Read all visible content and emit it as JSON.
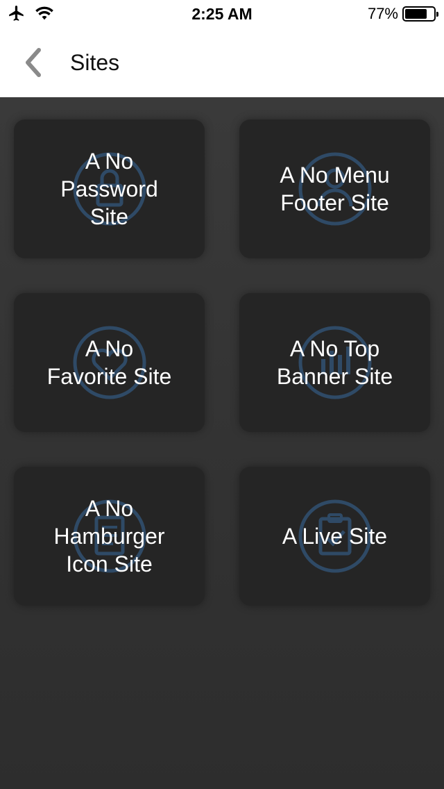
{
  "status_bar": {
    "time": "2:25 AM",
    "battery_percent": "77%",
    "battery_level": 0.77,
    "icons": [
      "airplane-icon",
      "wifi-icon",
      "battery-icon"
    ]
  },
  "nav": {
    "title": "Sites",
    "back_icon": "chevron-left-icon"
  },
  "tiles": [
    {
      "label": "A No\nPassword\nSite",
      "icon": "lock-icon"
    },
    {
      "label": "A No Menu\nFooter Site",
      "icon": "user-icon"
    },
    {
      "label": "A No\nFavorite Site",
      "icon": "heart-icon"
    },
    {
      "label": "A No Top\nBanner Site",
      "icon": "chart-icon"
    },
    {
      "label": "A No\nHamburger\nIcon Site",
      "icon": "document-icon"
    },
    {
      "label": "A Live Site",
      "icon": "clipboard-check-icon"
    }
  ],
  "colors": {
    "tile_background": "#252525",
    "content_background": "#333333",
    "icon_stroke": "#2f4a66",
    "text": "#ffffff"
  }
}
